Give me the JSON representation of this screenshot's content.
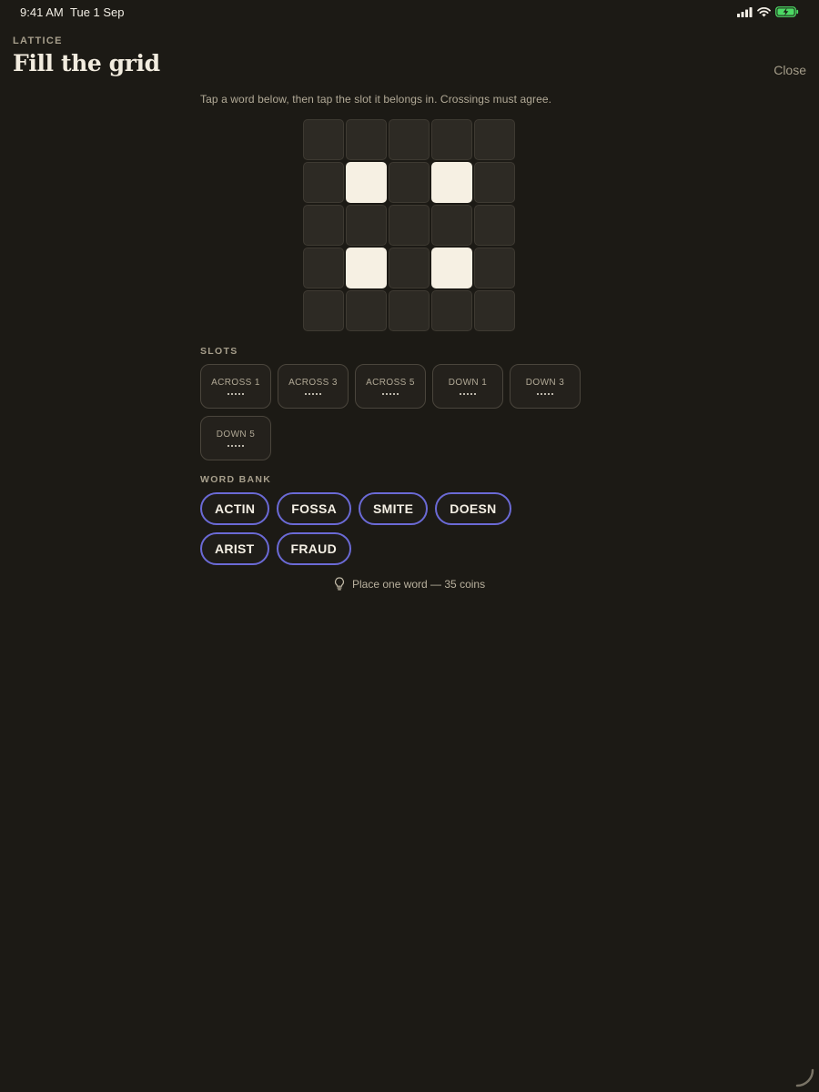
{
  "status_bar": {
    "time": "9:41 AM",
    "date": "Tue 1 Sep",
    "icons": [
      "cellular-signal-icon",
      "wifi-icon",
      "battery-charging-icon"
    ],
    "battery_color": "#4cd964"
  },
  "header": {
    "eyebrow": "LATTICE",
    "title": "Fill the grid",
    "close_label": "Close"
  },
  "instructions": "Tap a word below, then tap the slot it belongs in. Crossings must agree.",
  "grid": {
    "size": 5,
    "blocked_cells": [
      [
        1,
        1
      ],
      [
        1,
        3
      ],
      [
        3,
        1
      ],
      [
        3,
        3
      ]
    ],
    "open_color": "#2d2a24",
    "block_color": "#f6f0e3"
  },
  "slots": {
    "label": "SLOTS",
    "items": [
      {
        "name": "ACROSS 1",
        "length": 5
      },
      {
        "name": "ACROSS 3",
        "length": 5
      },
      {
        "name": "ACROSS 5",
        "length": 5
      },
      {
        "name": "DOWN 1",
        "length": 5
      },
      {
        "name": "DOWN 3",
        "length": 5
      },
      {
        "name": "DOWN 5",
        "length": 5
      }
    ]
  },
  "word_bank": {
    "label": "WORD BANK",
    "words": [
      "ACTIN",
      "FOSSA",
      "SMITE",
      "DOESN",
      "ARIST",
      "FRAUD"
    ],
    "accent_color": "#6b6ad6"
  },
  "hint": {
    "icon": "lightbulb-icon",
    "text": "Place one word — 35 coins"
  }
}
